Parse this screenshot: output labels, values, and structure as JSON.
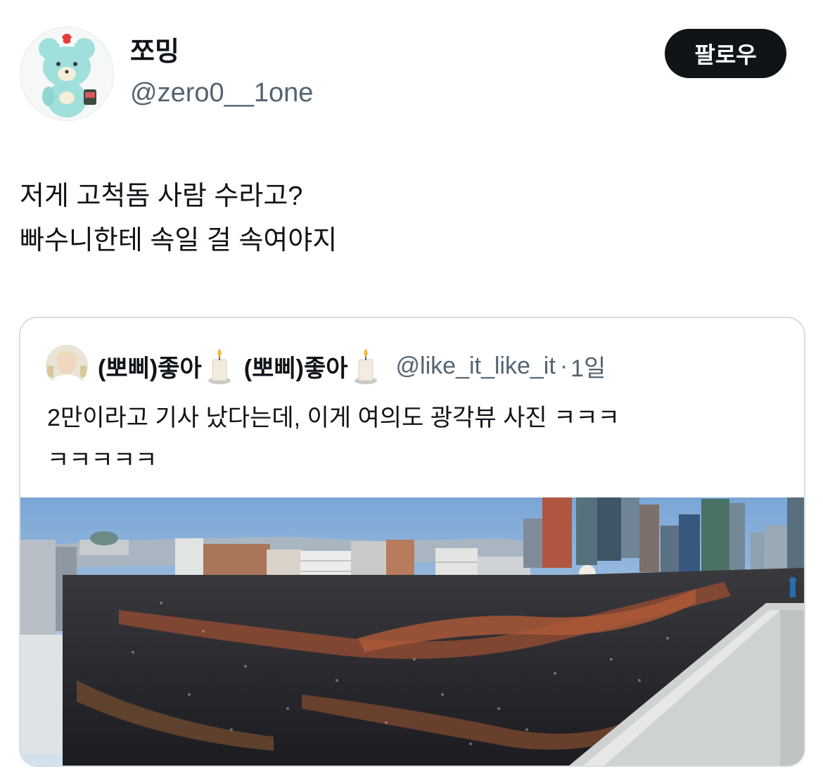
{
  "author": {
    "display_name": "쪼밍",
    "handle": "@zero0__1one",
    "avatar_icon": "teal-bear-plush-avatar"
  },
  "follow_button": {
    "label": "팔로우"
  },
  "tweet": {
    "lines": [
      "저게 고척돔 사람 수라고?",
      "빠수니한테 속일 걸 속여야지"
    ]
  },
  "quote": {
    "display_name_1": "(뽀삐)좋아",
    "display_name_2": "(뽀삐)좋아",
    "candle_icon": "candle-icon",
    "handle": "@like_it_like_it",
    "separator": "·",
    "time": "1일",
    "lines": [
      "2만이라고 기사 났다는데, 이게 여의도 광각뷰 사진 ㅋㅋㅋ",
      "ㅋㅋㅋㅋㅋ"
    ],
    "photo_icon": "crowd-panorama-photo"
  },
  "colors": {
    "text": "#0f1419",
    "secondary": "#536471",
    "border": "#d7dde2",
    "button_bg": "#0f1419",
    "button_text": "#ffffff"
  }
}
